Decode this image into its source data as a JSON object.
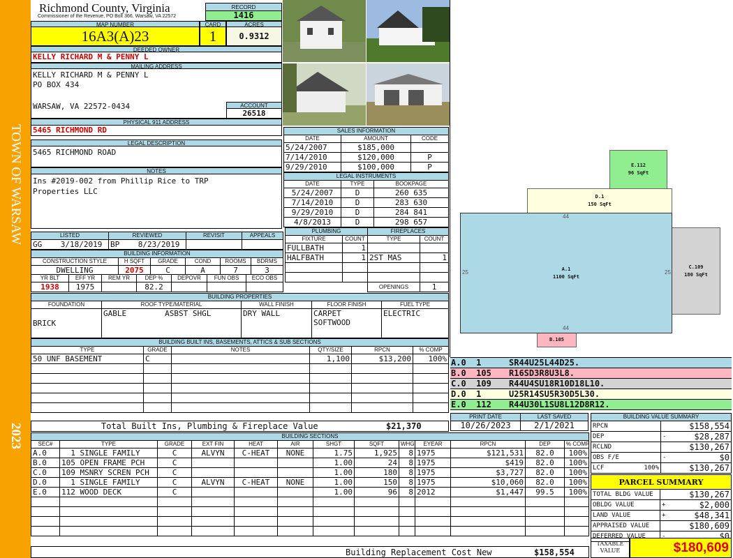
{
  "sidebar": {
    "town": "TOWN OF WARSAW",
    "year": "2023"
  },
  "header": {
    "county": "Richmond County, Virginia",
    "subtitle": "Commissioner of the Revenue, PO Box 366, Warsaw, VA 22572",
    "record_label": "RECORD",
    "record": "1416"
  },
  "parcel": {
    "map_label": "MAP NUMBER",
    "map": "16A3(A)23",
    "card_label": "CARD",
    "card": "1",
    "acres_label": "ACRES",
    "acres": "0.9312"
  },
  "owner": {
    "label": "DEEDED OWNER",
    "name": "KELLY RICHARD M & PENNY L"
  },
  "mailing": {
    "label": "MAILING ADDRESS",
    "line1": "KELLY RICHARD M & PENNY L",
    "line2": "PO BOX 434",
    "line3": "WARSAW, VA 22572-0434",
    "account_label": "ACCOUNT",
    "account": "26518"
  },
  "physical": {
    "label": "PHYSICAL 911 ADDRESS",
    "value": "5465 RICHMOND RD"
  },
  "legal": {
    "label": "LEGAL DESCRIPTION",
    "value": "5465 RICHMOND ROAD"
  },
  "notes": {
    "label": "NOTES",
    "value": "Ins #2019-002 from Phillip Rice to TRP\nProperties LLC"
  },
  "sales": {
    "label": "SALES INFORMATION",
    "headers": [
      "DATE",
      "AMOUNT",
      "CODE"
    ],
    "rows": [
      [
        "5/24/2007",
        "$185,000",
        ""
      ],
      [
        "7/14/2010",
        "$120,000",
        "P"
      ],
      [
        "9/29/2010",
        "$100,000",
        "P"
      ]
    ]
  },
  "instruments": {
    "label": "LEGAL INSTRUMENTS",
    "headers": [
      "DATE",
      "TYPE",
      "BOOKPAGE"
    ],
    "rows": [
      [
        "5/24/2007",
        "D",
        "260 635"
      ],
      [
        "7/14/2010",
        "D",
        "283 630"
      ],
      [
        "9/29/2010",
        "D",
        "284 841"
      ],
      [
        "4/8/2013",
        "D",
        "298 657"
      ]
    ]
  },
  "review": {
    "headers": [
      "LISTED",
      "REVIEWED",
      "REVISIT",
      "APPEALS"
    ],
    "listed": "GG    3/18/2019",
    "reviewed": "BP    8/23/2019",
    "revisit": "",
    "appeals": ""
  },
  "building_info": {
    "label": "BUILDING INFORMATION",
    "headers1": [
      "CONSTRUCTION STYLE",
      "H SQFT",
      "GRADE",
      "COND",
      "ROOMS",
      "BDRMS"
    ],
    "values1": [
      "DWELLING",
      "2075",
      "C",
      "A",
      "7",
      "3"
    ],
    "headers2": [
      "YR BLT",
      "EFF YR",
      "REM YR",
      "DEP %",
      "DEPOVR",
      "FUN OBS",
      "ECO OBS"
    ],
    "values2": [
      "1938",
      "1975",
      "",
      "82.2",
      "",
      "",
      ""
    ]
  },
  "plumbing": {
    "label": "PLUMBING",
    "headers": [
      "FIXTURE",
      "COUNT"
    ],
    "rows": [
      [
        "FULLBATH",
        "1"
      ],
      [
        "HALFBATH",
        "1"
      ]
    ]
  },
  "fireplaces": {
    "label": "FIREPLACES",
    "headers": [
      "TYPE",
      "COUNT"
    ],
    "rows": [
      [
        "",
        ""
      ],
      [
        "2ST MAS",
        "1"
      ]
    ],
    "openings_label": "OPENINGS",
    "openings": "1"
  },
  "properties": {
    "label": "BUILDING PROPERTIES",
    "headers": [
      "FOUNDATION",
      "ROOF TYPE/MATERIAL",
      "WALL FINISH",
      "FLOOR FINISH",
      "FUEL TYPE"
    ],
    "foundation": "BRICK",
    "roof_type": "GABLE",
    "roof_material": "ASBST SHGL",
    "wall": "DRY WALL",
    "floor1": "CARPET",
    "floor2": "SOFTWOOD",
    "fuel": "ELECTRIC"
  },
  "builtins": {
    "label": "BUILDING BUILT INS, BASEMENTS, ATTICS & SUB SECTIONS",
    "headers": [
      "TYPE",
      "GRADE",
      "NOTES",
      "QTY/SIZE",
      "RPCN",
      "% COMP"
    ],
    "rows": [
      [
        "50 UNF BASEMENT",
        "C",
        "",
        "1,100",
        "$13,200",
        "100%"
      ],
      [
        "",
        "",
        "",
        "",
        "",
        ""
      ],
      [
        "",
        "",
        "",
        "",
        "",
        ""
      ],
      [
        "",
        "",
        "",
        "",
        "",
        ""
      ],
      [
        "",
        "",
        "",
        "",
        "",
        ""
      ],
      [
        "",
        "",
        "",
        "",
        "",
        ""
      ]
    ],
    "total_label": "Total Built Ins, Plumbing & Fireplace Value",
    "total": "$21,370"
  },
  "dates": {
    "print_label": "PRINT DATE",
    "print": "10/26/2023",
    "saved_label": "LAST SAVED",
    "saved": "2/1/2021"
  },
  "sections": {
    "label": "BUILDING SECTIONS",
    "headers": [
      "SEC#",
      "TYPE",
      "GRADE",
      "EXT FIN",
      "HEAT",
      "AIR",
      "SHGT",
      "SQFT",
      "WHGT",
      "EYEAR",
      "RPCN",
      "DEP",
      "% COMP"
    ],
    "rows": [
      [
        "A.0",
        "  1 SINGLE FAMILY",
        "C",
        "ALVYN",
        "C-HEAT",
        "NONE",
        "1.75",
        "1,925",
        "8",
        "1975",
        "$121,531",
        "82.0",
        "100%"
      ],
      [
        "B.0",
        "105 OPEN FRAME PCH",
        "C",
        "",
        "",
        "",
        "1.00",
        "24",
        "8",
        "1975",
        "$419",
        "82.0",
        "100%"
      ],
      [
        "C.0",
        "109 MSNRY SCREN PCH",
        "C",
        "",
        "",
        "",
        "1.00",
        "180",
        "8",
        "1975",
        "$3,727",
        "82.0",
        "100%"
      ],
      [
        "D.0",
        "  1 SINGLE FAMILY",
        "C",
        "ALVYN",
        "C-HEAT",
        "NONE",
        "1.00",
        "150",
        "8",
        "1975",
        "$10,060",
        "82.0",
        "100%"
      ],
      [
        "E.0",
        "112 WOOD DECK",
        "C",
        "",
        "",
        "",
        "1.00",
        "96",
        "8",
        "2012",
        "$1,447",
        "99.5",
        "100%"
      ],
      [
        "",
        "",
        "",
        "",
        "",
        "",
        "",
        "",
        "",
        "",
        "",
        "",
        ""
      ],
      [
        "",
        "",
        "",
        "",
        "",
        "",
        "",
        "",
        "",
        "",
        "",
        "",
        ""
      ],
      [
        "",
        "",
        "",
        "",
        "",
        "",
        "",
        "",
        "",
        "",
        "",
        "",
        ""
      ],
      [
        "",
        "",
        "",
        "",
        "",
        "",
        "",
        "",
        "",
        "",
        "",
        "",
        ""
      ]
    ],
    "total_label": "Building Replacement Cost New",
    "total": "$158,554"
  },
  "value_summary": {
    "label": "BUILDING VALUE SUMMARY",
    "rows": [
      [
        "RPCN",
        "",
        "",
        "$158,554"
      ],
      [
        "DEP",
        "",
        "-",
        "$28,287"
      ],
      [
        "RCLND",
        "",
        "",
        "$130,267"
      ],
      [
        "OBS F/E",
        "",
        "-",
        "$0"
      ],
      [
        "LCF",
        "100%",
        "",
        "$130,267"
      ]
    ]
  },
  "parcel_summary": {
    "title": "PARCEL SUMMARY",
    "rows": [
      [
        "TOTAL BLDG VALUE",
        "",
        "$130,267"
      ],
      [
        "OBLDG VALUE",
        "+",
        "$2,000"
      ],
      [
        "LAND VALUE",
        "+",
        "$48,341"
      ],
      [
        "APPRAISED VALUE",
        "",
        "$180,609"
      ],
      [
        "DEFERRED VALUE",
        "-",
        "$0"
      ]
    ],
    "taxable_label": "TAXABLE VALUE",
    "taxable": "$180,609"
  },
  "sketch": {
    "shapes": {
      "a_label": "A.1",
      "a_area": "1100 SqFt",
      "b_label": "B.105",
      "c_label": "C.109",
      "c_area": "180 SqFt",
      "d_label": "D.1",
      "d_area": "150 SqFt",
      "e_label": "E.112",
      "e_area": "96 SqFt",
      "dim_top": "44",
      "dim_bottom": "44",
      "dim_left": "25",
      "dim_right": "25"
    },
    "legend": [
      [
        "A.0",
        "1",
        "SR44U25L44D25."
      ],
      [
        "B.0",
        "105",
        "R16SD3R8U3L8."
      ],
      [
        "C.0",
        "109",
        "R44U4SU18R10D18L10."
      ],
      [
        "D.0",
        "1",
        "U25R14SU5R30D5L30."
      ],
      [
        "E.0",
        "112",
        "R44U30L1SU8L12D8R12."
      ]
    ],
    "colors": {
      "A": "#add8e6",
      "B": "#ffb6c1",
      "C": "#d3d3d3",
      "D": "#ffffe0",
      "E": "#90ee90"
    }
  }
}
